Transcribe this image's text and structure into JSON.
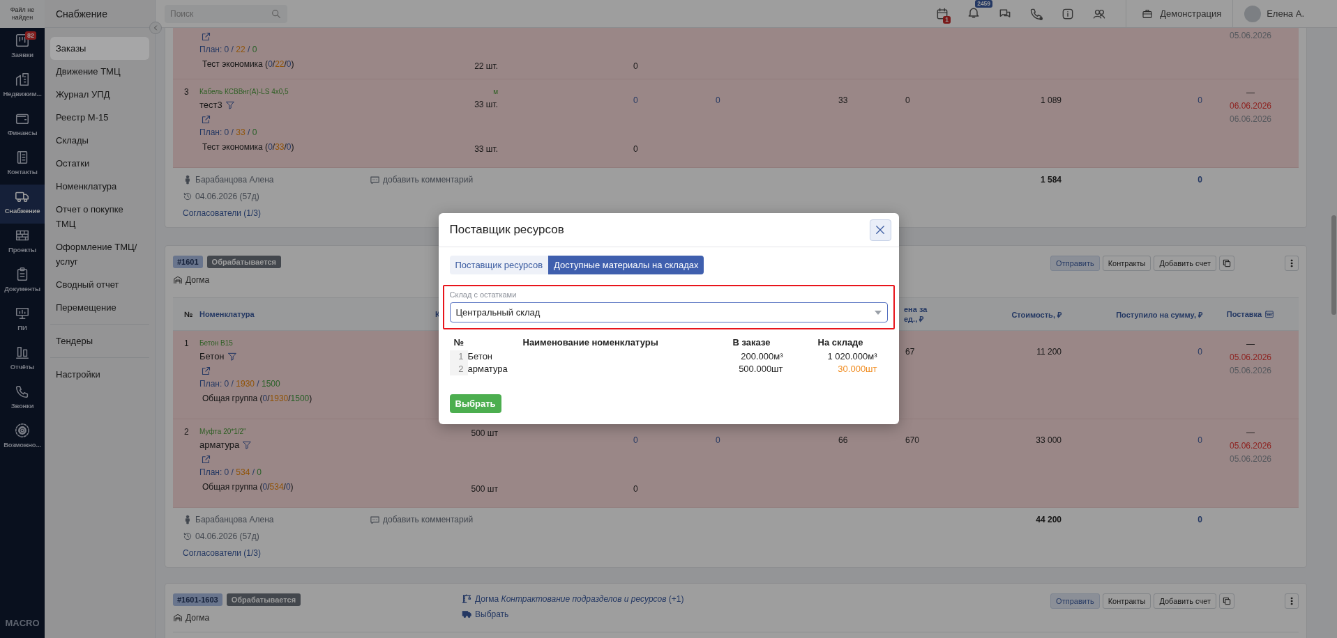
{
  "rail": {
    "logo_text": "Файл не найден",
    "brand": "MACRO",
    "items": [
      {
        "label": "Заявки",
        "badge": "82",
        "selected": false
      },
      {
        "label": "Недвижим...",
        "selected": false
      },
      {
        "label": "Финансы",
        "selected": false
      },
      {
        "label": "Контакты",
        "selected": false
      },
      {
        "label": "Снабжение",
        "selected": true
      },
      {
        "label": "Проекты",
        "selected": false
      },
      {
        "label": "Документы",
        "selected": false
      },
      {
        "label": "ПИ",
        "selected": false
      },
      {
        "label": "Отчёты",
        "selected": false
      },
      {
        "label": "Звонки",
        "selected": false
      },
      {
        "label": "Возможно...",
        "selected": false
      }
    ]
  },
  "sidebar": {
    "title": "Снабжение",
    "sections": [
      {
        "items": [
          {
            "label": "Заказы",
            "selected": true
          },
          {
            "label": "Движение ТМЦ",
            "selected": false
          },
          {
            "label": "Журнал УПД",
            "selected": false
          },
          {
            "label": "Реестр М-15",
            "selected": false
          },
          {
            "label": "Склады",
            "selected": false
          },
          {
            "label": "Остатки",
            "selected": false
          },
          {
            "label": "Номенклатура",
            "selected": false
          },
          {
            "label": "Отчет о покупке ТМЦ",
            "selected": false
          },
          {
            "label": "Оформление ТМЦ/ услуг",
            "selected": false
          },
          {
            "label": "Сводный отчет",
            "selected": false
          },
          {
            "label": "Перемещение",
            "selected": false
          }
        ]
      },
      {
        "items": [
          {
            "label": "Тендеры",
            "selected": false
          }
        ]
      },
      {
        "items": [
          {
            "label": "Настройки",
            "selected": false
          }
        ]
      }
    ]
  },
  "topbar": {
    "search": {
      "placeholder": "Поиск"
    },
    "badges": [
      {
        "text": "1",
        "color": "#7a1a1a"
      },
      {
        "text": "2459",
        "color": "#243863"
      }
    ],
    "company": "Демонстрация",
    "user": "Елена А."
  },
  "orders": [
    {
      "rows": [
        {
          "plan": [
            {
              "text": "План: 0 / "
            },
            {
              "text": "22",
              "color": "#905307"
            },
            {
              "text": " / "
            },
            {
              "text": "0",
              "color": "#265f26"
            }
          ],
          "group": [
            {
              "text": "Тест экономика  ("
            },
            {
              "text": "0",
              "color": "#243863"
            },
            {
              "text": "/"
            },
            {
              "text": "22",
              "color": "#905307"
            },
            {
              "text": "/"
            },
            {
              "text": "0",
              "color": "#243863"
            },
            {
              "text": ")"
            }
          ],
          "sub_qty": "22 шт.",
          "sub_column_4": "0",
          "delivery": [
            {
              "text": "05.06.2026",
              "color": "#56595e"
            }
          ]
        },
        {
          "number": "3",
          "code": "Кабель КСВВнг(А)-LS 4x0,5",
          "name": "тест3",
          "unit": "м",
          "qty": "33 шт.",
          "column_4": "0",
          "column_5": "0",
          "column_6": "33",
          "price": "0",
          "cost": "1 089",
          "received": "0",
          "delivery": [
            {
              "text": "—"
            },
            {
              "text": "06.06.2026",
              "color": "#8e2321"
            },
            {
              "text": "06.06.2026",
              "color": "#56595e"
            }
          ],
          "plan": [
            {
              "text": "План: 0 / "
            },
            {
              "text": "33",
              "color": "#905307"
            },
            {
              "text": " / "
            },
            {
              "text": "0",
              "color": "#265f26"
            }
          ],
          "group": [
            {
              "text": "Тест экономика  ("
            },
            {
              "text": "0",
              "color": "#243863"
            },
            {
              "text": "/"
            },
            {
              "text": "33",
              "color": "#905307"
            },
            {
              "text": "/"
            },
            {
              "text": "0",
              "color": "#243863"
            },
            {
              "text": ")"
            }
          ],
          "sub_qty": "33 шт.",
          "sub_column_4": "0"
        }
      ],
      "footer": {
        "author": "Барабанцова Алена",
        "comment": "добавить комментарий",
        "created": "04.06.2026 (57д)",
        "approvers": "Согласователи (1/3)",
        "total_cost": "1 584",
        "total_received": "0"
      }
    },
    {
      "id": "#1601",
      "status": "Обрабатывается",
      "warehouse": "Догма",
      "actions": [
        {
          "label": "Отправить",
          "kind": "primary"
        },
        {
          "label": "Контракты",
          "kind": "plain"
        },
        {
          "label": "Добавить счет",
          "kind": "plain"
        }
      ],
      "columns": {
        "number": "№",
        "nomenclature": "Номенклатура",
        "column_3": "К",
        "price": "ена за ед., ₽",
        "cost": "Стоимость, ₽",
        "received": "Поступило на сумму, ₽",
        "delivery": "Поставка"
      },
      "rows": [
        {
          "number": "1",
          "code": "Бетон В15",
          "name": "Бетон",
          "price": "67",
          "cost": "11 200",
          "received": "0",
          "delivery": [
            {
              "text": "—"
            },
            {
              "text": "05.06.2026",
              "color": "#8e2321"
            },
            {
              "text": "05.06.2026",
              "color": "#56595e"
            }
          ],
          "plan": [
            {
              "text": "План: 0 / "
            },
            {
              "text": "1930",
              "color": "#905307"
            },
            {
              "text": " / "
            },
            {
              "text": "1500",
              "color": "#265f26"
            }
          ],
          "group": [
            {
              "text": "Общая группа  ("
            },
            {
              "text": "0",
              "color": "#243863"
            },
            {
              "text": "/"
            },
            {
              "text": "1930",
              "color": "#905307"
            },
            {
              "text": "/"
            },
            {
              "text": "1500",
              "color": "#265f26"
            },
            {
              "text": ")"
            }
          ]
        },
        {
          "number": "2",
          "code": "Муфта 20*1/2\"",
          "name": "арматура",
          "qty": "500 шт",
          "column_4": "0",
          "column_5": "0",
          "column_6": "66",
          "price": "670",
          "cost": "33 000",
          "received": "0",
          "delivery": [
            {
              "text": "—"
            },
            {
              "text": "05.06.2026",
              "color": "#8e2321"
            },
            {
              "text": "05.06.2026",
              "color": "#56595e"
            }
          ],
          "plan": [
            {
              "text": "План: 0 / "
            },
            {
              "text": "534",
              "color": "#905307"
            },
            {
              "text": " / "
            },
            {
              "text": "0",
              "color": "#265f26"
            }
          ],
          "group": [
            {
              "text": "Общая группа  ("
            },
            {
              "text": "0",
              "color": "#243863"
            },
            {
              "text": "/"
            },
            {
              "text": "534",
              "color": "#905307"
            },
            {
              "text": "/"
            },
            {
              "text": "0",
              "color": "#243863"
            },
            {
              "text": ")"
            }
          ],
          "sub_qty": "500 шт",
          "sub_column_4": "0"
        }
      ],
      "footer": {
        "author": "Барабанцова Алена",
        "comment": "добавить комментарий",
        "created": "04.06.2026 (57д)",
        "approvers": "Согласователи (1/3)",
        "total_cost": "44 200",
        "total_received": "0"
      }
    },
    {
      "id": "#1601-1603",
      "status": "Обрабатывается",
      "warehouse": "Догма",
      "project": "Догма *Контрактование подразделов и ресурсов* (+1)",
      "delivery_action": "Выбрать",
      "actions": [
        {
          "label": "Отправить",
          "kind": "primary"
        },
        {
          "label": "Контракты",
          "kind": "plain"
        },
        {
          "label": "Добавить счет",
          "kind": "plain"
        }
      ]
    }
  ],
  "modal": {
    "title": "Поставщик ресурсов",
    "tabs": [
      {
        "label": "Поставщик ресурсов",
        "selected": false
      },
      {
        "label": "Доступные материалы на складах",
        "selected": true
      }
    ],
    "field": {
      "label": "Склад с остатками",
      "value": "Центральный склад",
      "highlighted": true
    },
    "table": {
      "columns": [
        "№",
        "Наименование номенклатуры",
        "В заказе",
        "На складе"
      ],
      "rows": [
        {
          "number": "1",
          "name": "Бетон",
          "ordered": "200.000м³",
          "in_stock": "1 020.000м³",
          "shortage": false
        },
        {
          "number": "2",
          "name": "арматура",
          "ordered": "500.000шт",
          "in_stock": "30.000шт",
          "shortage": true
        }
      ]
    },
    "button": "Выбрать"
  }
}
